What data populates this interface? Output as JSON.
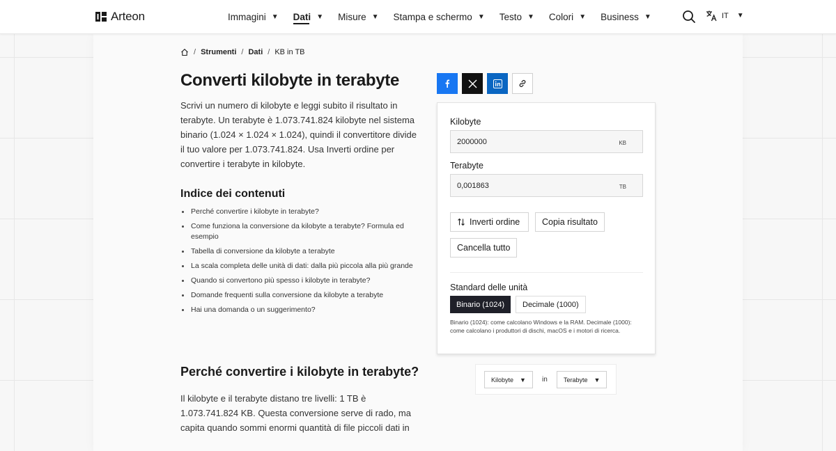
{
  "header": {
    "brand": "Arteon",
    "nav": [
      {
        "label": "Immagini",
        "active": false
      },
      {
        "label": "Dati",
        "active": true
      },
      {
        "label": "Misure",
        "active": false
      },
      {
        "label": "Stampa e schermo",
        "active": false
      },
      {
        "label": "Testo",
        "active": false
      },
      {
        "label": "Colori",
        "active": false
      },
      {
        "label": "Business",
        "active": false
      }
    ],
    "search_icon": "search-icon",
    "language": "IT",
    "language_icon": "translate-icon"
  },
  "breadcrumb": {
    "home_icon": "home-icon",
    "items": [
      "Strumenti",
      "Dati",
      "KB in TB"
    ]
  },
  "page": {
    "title": "Converti kilobyte in terabyte",
    "intro": "Scrivi un numero di kilobyte e leggi subito il risultato in terabyte. Un terabyte è 1.073.741.824 kilobyte nel sistema binario (1.024 × 1.024 × 1.024), quindi il convertitore divide il tuo valore per 1.073.741.824. Usa Inverti ordine per convertire i terabyte in kilobyte.",
    "toc_title": "Indice dei contenuti",
    "toc": [
      "Perché convertire i kilobyte in terabyte?",
      "Come funziona la conversione da kilobyte a terabyte? Formula ed esempio",
      "Tabella di conversione da kilobyte a terabyte",
      "La scala completa delle unità di dati: dalla più piccola alla più grande",
      "Quando si convertono più spesso i kilobyte in terabyte?",
      "Domande frequenti sulla conversione da kilobyte a terabyte",
      "Hai una domanda o un suggerimento?"
    ],
    "section_title": "Perché convertire i kilobyte in terabyte?",
    "section_text": "Il kilobyte e il terabyte distano tre livelli: 1 TB è 1.073.741.824 KB. Questa conversione serve di rado, ma capita quando sommi enormi quantità di file piccoli dati in"
  },
  "share": {
    "icons": [
      "facebook-icon",
      "x-icon",
      "linkedin-icon",
      "link-icon"
    ],
    "colors": {
      "facebook": "#1877f2",
      "x": "#111111",
      "linkedin": "#0a66c2"
    }
  },
  "converter": {
    "from_label": "Kilobyte",
    "from_value": "2000000",
    "from_unit": "KB",
    "to_label": "Terabyte",
    "to_value": "0,001863",
    "to_unit": "TB",
    "swap_label": "Inverti ordine",
    "copy_label": "Copia risultato",
    "clear_label": "Cancella tutto",
    "standard_label": "Standard delle unità",
    "binary_label": "Binario (1024)",
    "decimal_label": "Decimale (1000)",
    "selected_standard": "Binario (1024)",
    "note": "Binario (1024): come calcolano Windows e la RAM. Decimale (1000): come calcolano i produttori di dischi, macOS e i motori di ricerca."
  },
  "unit_picker": {
    "from": "Kilobyte",
    "connector": "in",
    "to": "Terabyte"
  },
  "colors": {
    "accent_dark": "#1f2029",
    "text": "#1a1a1a"
  }
}
